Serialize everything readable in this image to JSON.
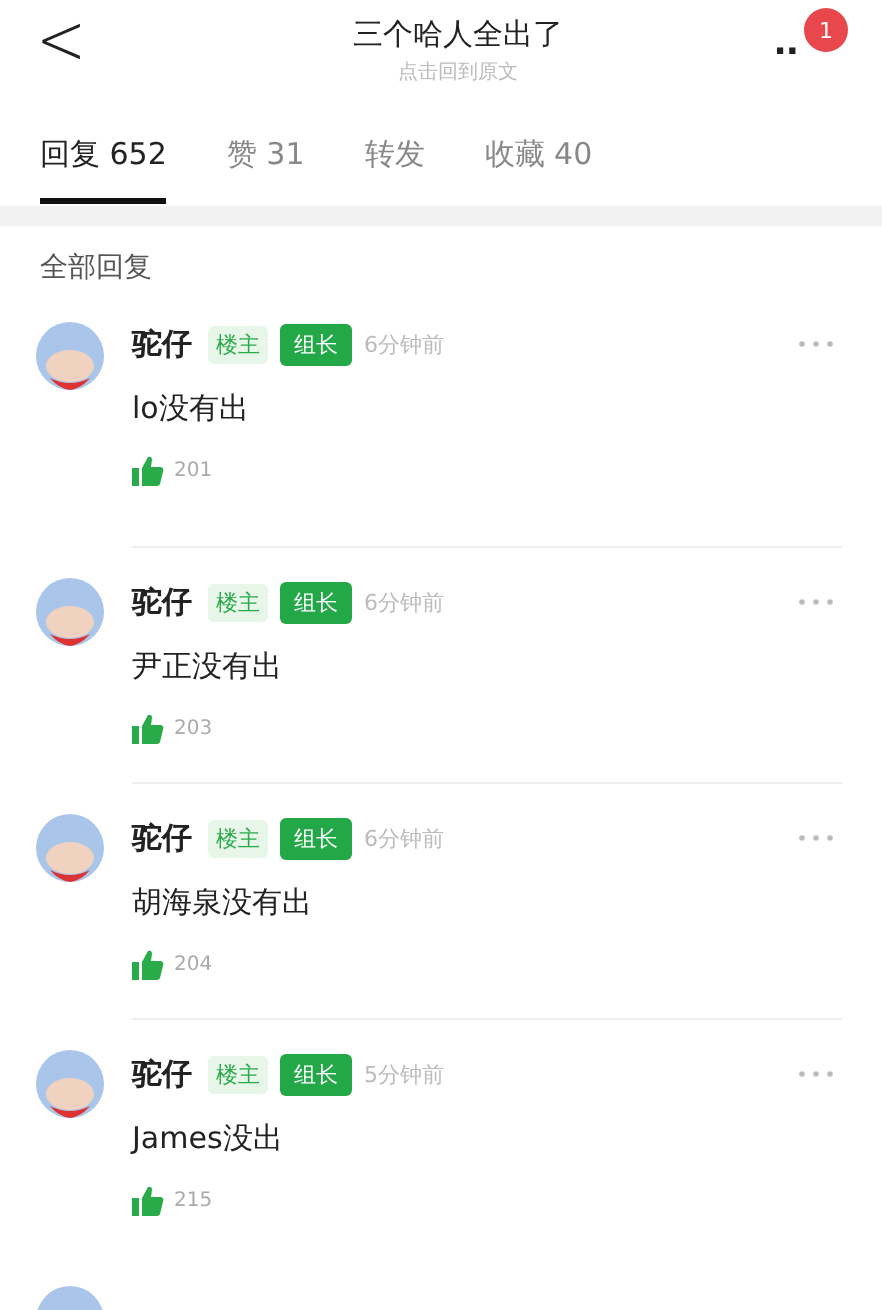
{
  "header": {
    "back": "<",
    "title": "三个哈人全出了",
    "subtitle": "点击回到原文",
    "more": "..",
    "notification_count": "1"
  },
  "tabs": [
    {
      "label": "回复",
      "count": "652",
      "selected": true
    },
    {
      "label": "赞",
      "count": "31",
      "selected": false
    },
    {
      "label": "转发",
      "selected": false
    },
    {
      "label": "收藏",
      "count": "40",
      "selected": false
    }
  ],
  "section_title": "全部回复",
  "comments": [
    {
      "author": "驼仔",
      "badges": [
        "楼主",
        "组长"
      ],
      "time": "6分钟前",
      "text": "lo没有出",
      "likes": "201"
    },
    {
      "author": "驼仔",
      "badges": [
        "楼主",
        "组长"
      ],
      "time": "6分钟前",
      "text": "尹正没有出",
      "likes": "203"
    },
    {
      "author": "驼仔",
      "badges": [
        "楼主",
        "组长"
      ],
      "time": "6分钟前",
      "text": "胡海泉没有出",
      "likes": "204"
    },
    {
      "author": "驼仔",
      "badges": [
        "楼主",
        "组长"
      ],
      "time": "5分钟前",
      "text": "James没出",
      "likes": "215"
    }
  ]
}
